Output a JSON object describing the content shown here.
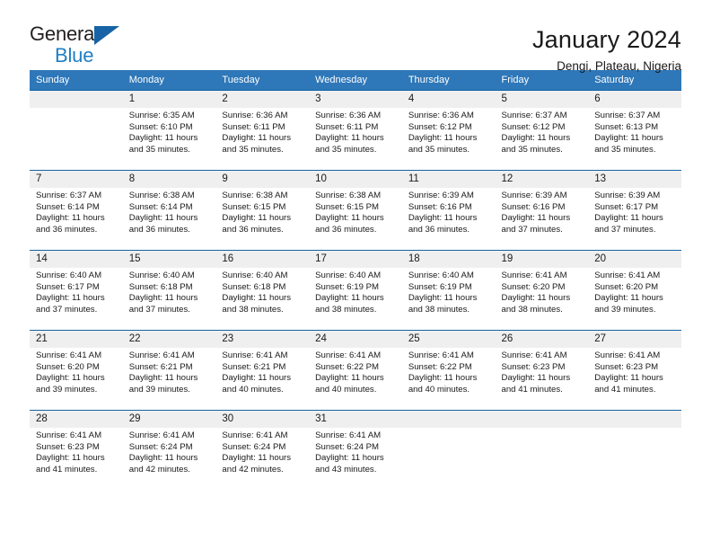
{
  "brand": {
    "name_part1": "General",
    "name_part2": "Blue"
  },
  "header": {
    "title": "January 2024",
    "location": "Dengi, Plateau, Nigeria"
  },
  "calendar": {
    "weekday_headers": [
      "Sunday",
      "Monday",
      "Tuesday",
      "Wednesday",
      "Thursday",
      "Friday",
      "Saturday"
    ],
    "colors": {
      "header_bg": "#2e77b8",
      "header_text": "#ffffff",
      "row_rule": "#1763a5",
      "daynum_bg": "#efefef",
      "brand_blue": "#1f7fc4"
    },
    "weeks": [
      [
        {
          "day": "",
          "sunrise": "",
          "sunset": "",
          "daylight_line1": "",
          "daylight_line2": ""
        },
        {
          "day": "1",
          "sunrise": "Sunrise: 6:35 AM",
          "sunset": "Sunset: 6:10 PM",
          "daylight_line1": "Daylight: 11 hours",
          "daylight_line2": "and 35 minutes."
        },
        {
          "day": "2",
          "sunrise": "Sunrise: 6:36 AM",
          "sunset": "Sunset: 6:11 PM",
          "daylight_line1": "Daylight: 11 hours",
          "daylight_line2": "and 35 minutes."
        },
        {
          "day": "3",
          "sunrise": "Sunrise: 6:36 AM",
          "sunset": "Sunset: 6:11 PM",
          "daylight_line1": "Daylight: 11 hours",
          "daylight_line2": "and 35 minutes."
        },
        {
          "day": "4",
          "sunrise": "Sunrise: 6:36 AM",
          "sunset": "Sunset: 6:12 PM",
          "daylight_line1": "Daylight: 11 hours",
          "daylight_line2": "and 35 minutes."
        },
        {
          "day": "5",
          "sunrise": "Sunrise: 6:37 AM",
          "sunset": "Sunset: 6:12 PM",
          "daylight_line1": "Daylight: 11 hours",
          "daylight_line2": "and 35 minutes."
        },
        {
          "day": "6",
          "sunrise": "Sunrise: 6:37 AM",
          "sunset": "Sunset: 6:13 PM",
          "daylight_line1": "Daylight: 11 hours",
          "daylight_line2": "and 35 minutes."
        }
      ],
      [
        {
          "day": "7",
          "sunrise": "Sunrise: 6:37 AM",
          "sunset": "Sunset: 6:14 PM",
          "daylight_line1": "Daylight: 11 hours",
          "daylight_line2": "and 36 minutes."
        },
        {
          "day": "8",
          "sunrise": "Sunrise: 6:38 AM",
          "sunset": "Sunset: 6:14 PM",
          "daylight_line1": "Daylight: 11 hours",
          "daylight_line2": "and 36 minutes."
        },
        {
          "day": "9",
          "sunrise": "Sunrise: 6:38 AM",
          "sunset": "Sunset: 6:15 PM",
          "daylight_line1": "Daylight: 11 hours",
          "daylight_line2": "and 36 minutes."
        },
        {
          "day": "10",
          "sunrise": "Sunrise: 6:38 AM",
          "sunset": "Sunset: 6:15 PM",
          "daylight_line1": "Daylight: 11 hours",
          "daylight_line2": "and 36 minutes."
        },
        {
          "day": "11",
          "sunrise": "Sunrise: 6:39 AM",
          "sunset": "Sunset: 6:16 PM",
          "daylight_line1": "Daylight: 11 hours",
          "daylight_line2": "and 36 minutes."
        },
        {
          "day": "12",
          "sunrise": "Sunrise: 6:39 AM",
          "sunset": "Sunset: 6:16 PM",
          "daylight_line1": "Daylight: 11 hours",
          "daylight_line2": "and 37 minutes."
        },
        {
          "day": "13",
          "sunrise": "Sunrise: 6:39 AM",
          "sunset": "Sunset: 6:17 PM",
          "daylight_line1": "Daylight: 11 hours",
          "daylight_line2": "and 37 minutes."
        }
      ],
      [
        {
          "day": "14",
          "sunrise": "Sunrise: 6:40 AM",
          "sunset": "Sunset: 6:17 PM",
          "daylight_line1": "Daylight: 11 hours",
          "daylight_line2": "and 37 minutes."
        },
        {
          "day": "15",
          "sunrise": "Sunrise: 6:40 AM",
          "sunset": "Sunset: 6:18 PM",
          "daylight_line1": "Daylight: 11 hours",
          "daylight_line2": "and 37 minutes."
        },
        {
          "day": "16",
          "sunrise": "Sunrise: 6:40 AM",
          "sunset": "Sunset: 6:18 PM",
          "daylight_line1": "Daylight: 11 hours",
          "daylight_line2": "and 38 minutes."
        },
        {
          "day": "17",
          "sunrise": "Sunrise: 6:40 AM",
          "sunset": "Sunset: 6:19 PM",
          "daylight_line1": "Daylight: 11 hours",
          "daylight_line2": "and 38 minutes."
        },
        {
          "day": "18",
          "sunrise": "Sunrise: 6:40 AM",
          "sunset": "Sunset: 6:19 PM",
          "daylight_line1": "Daylight: 11 hours",
          "daylight_line2": "and 38 minutes."
        },
        {
          "day": "19",
          "sunrise": "Sunrise: 6:41 AM",
          "sunset": "Sunset: 6:20 PM",
          "daylight_line1": "Daylight: 11 hours",
          "daylight_line2": "and 38 minutes."
        },
        {
          "day": "20",
          "sunrise": "Sunrise: 6:41 AM",
          "sunset": "Sunset: 6:20 PM",
          "daylight_line1": "Daylight: 11 hours",
          "daylight_line2": "and 39 minutes."
        }
      ],
      [
        {
          "day": "21",
          "sunrise": "Sunrise: 6:41 AM",
          "sunset": "Sunset: 6:20 PM",
          "daylight_line1": "Daylight: 11 hours",
          "daylight_line2": "and 39 minutes."
        },
        {
          "day": "22",
          "sunrise": "Sunrise: 6:41 AM",
          "sunset": "Sunset: 6:21 PM",
          "daylight_line1": "Daylight: 11 hours",
          "daylight_line2": "and 39 minutes."
        },
        {
          "day": "23",
          "sunrise": "Sunrise: 6:41 AM",
          "sunset": "Sunset: 6:21 PM",
          "daylight_line1": "Daylight: 11 hours",
          "daylight_line2": "and 40 minutes."
        },
        {
          "day": "24",
          "sunrise": "Sunrise: 6:41 AM",
          "sunset": "Sunset: 6:22 PM",
          "daylight_line1": "Daylight: 11 hours",
          "daylight_line2": "and 40 minutes."
        },
        {
          "day": "25",
          "sunrise": "Sunrise: 6:41 AM",
          "sunset": "Sunset: 6:22 PM",
          "daylight_line1": "Daylight: 11 hours",
          "daylight_line2": "and 40 minutes."
        },
        {
          "day": "26",
          "sunrise": "Sunrise: 6:41 AM",
          "sunset": "Sunset: 6:23 PM",
          "daylight_line1": "Daylight: 11 hours",
          "daylight_line2": "and 41 minutes."
        },
        {
          "day": "27",
          "sunrise": "Sunrise: 6:41 AM",
          "sunset": "Sunset: 6:23 PM",
          "daylight_line1": "Daylight: 11 hours",
          "daylight_line2": "and 41 minutes."
        }
      ],
      [
        {
          "day": "28",
          "sunrise": "Sunrise: 6:41 AM",
          "sunset": "Sunset: 6:23 PM",
          "daylight_line1": "Daylight: 11 hours",
          "daylight_line2": "and 41 minutes."
        },
        {
          "day": "29",
          "sunrise": "Sunrise: 6:41 AM",
          "sunset": "Sunset: 6:24 PM",
          "daylight_line1": "Daylight: 11 hours",
          "daylight_line2": "and 42 minutes."
        },
        {
          "day": "30",
          "sunrise": "Sunrise: 6:41 AM",
          "sunset": "Sunset: 6:24 PM",
          "daylight_line1": "Daylight: 11 hours",
          "daylight_line2": "and 42 minutes."
        },
        {
          "day": "31",
          "sunrise": "Sunrise: 6:41 AM",
          "sunset": "Sunset: 6:24 PM",
          "daylight_line1": "Daylight: 11 hours",
          "daylight_line2": "and 43 minutes."
        },
        {
          "day": "",
          "sunrise": "",
          "sunset": "",
          "daylight_line1": "",
          "daylight_line2": ""
        },
        {
          "day": "",
          "sunrise": "",
          "sunset": "",
          "daylight_line1": "",
          "daylight_line2": ""
        },
        {
          "day": "",
          "sunrise": "",
          "sunset": "",
          "daylight_line1": "",
          "daylight_line2": ""
        }
      ]
    ]
  }
}
